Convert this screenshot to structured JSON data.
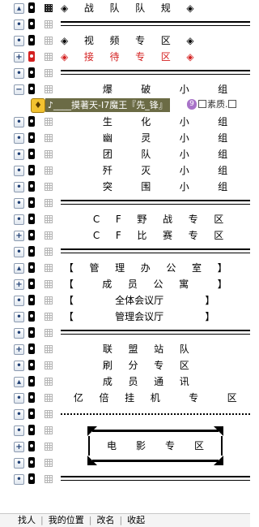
{
  "tree": [
    {
      "kind": "item",
      "ctl": "lock",
      "tag": "black",
      "grid": "dark",
      "text": "◈ 　 战 　 队 　 队 　 规 　 ◈"
    },
    {
      "kind": "sep",
      "style": "double"
    },
    {
      "kind": "item",
      "ctl": "dot",
      "tag": "black",
      "grid": "light",
      "text": "◈ 　 视 　 频 　 专 　 区 　 ◈"
    },
    {
      "kind": "item",
      "ctl": "plus",
      "tag": "red",
      "grid": "light",
      "text": "◈ 　 接 　 待 　 专 　 区 　 ◈",
      "color": "red"
    },
    {
      "kind": "sep",
      "style": "double"
    },
    {
      "kind": "item",
      "ctl": "minus",
      "tag": "black",
      "grid": "light",
      "text": "　　　　 爆 　 　 破 　 　 小 　 　 组"
    },
    {
      "kind": "user",
      "name": "♪____摸著天-Ι7魔王『先_锋』",
      "extra": "素质.",
      "extra2": "9"
    },
    {
      "kind": "item",
      "ctl": "dot",
      "tag": "black",
      "grid": "light",
      "text": "　　　　 生 　 　 化 　 　 小 　 　 组"
    },
    {
      "kind": "item",
      "ctl": "dot",
      "tag": "black",
      "grid": "light",
      "text": "　　　　 幽 　 　 灵 　 　 小 　 　 组"
    },
    {
      "kind": "item",
      "ctl": "dot",
      "tag": "black",
      "grid": "light",
      "text": "　　　　 团 　 　 队 　 　 小 　 　 组"
    },
    {
      "kind": "item",
      "ctl": "dot",
      "tag": "black",
      "grid": "light",
      "text": "　　　　 歼 　 　 灭 　 　 小 　 　 组"
    },
    {
      "kind": "item",
      "ctl": "dot",
      "tag": "black",
      "grid": "light",
      "text": "　　　　 突 　 　 围 　 　 小 　 　 组"
    },
    {
      "kind": "sep",
      "style": "double"
    },
    {
      "kind": "item",
      "ctl": "dot",
      "tag": "black",
      "grid": "light",
      "text": "　　　 C 　 F 　 野 　 战 　 专 　 区"
    },
    {
      "kind": "item",
      "ctl": "plus",
      "tag": "black",
      "grid": "light",
      "text": "　　　 C 　 F 　 比 　 赛 　 专 　 区"
    },
    {
      "kind": "sep",
      "style": "double"
    },
    {
      "kind": "item",
      "ctl": "lock",
      "tag": "black",
      "grid": "light",
      "text": " 【 　 管 　 理 　 办 　 公 　 室 　 】"
    },
    {
      "kind": "item",
      "ctl": "plus",
      "tag": "black",
      "grid": "light",
      "text": " 【 　 　 成 　 员 　 公 　 寓 　 　 】"
    },
    {
      "kind": "item",
      "ctl": "dot",
      "tag": "black",
      "grid": "light",
      "text": " 【 　 　 　 全体会议厅 　 　 　 】"
    },
    {
      "kind": "item",
      "ctl": "dot",
      "tag": "black",
      "grid": "light",
      "text": " 【 　 　 　 管理会议厅 　 　 　 】"
    },
    {
      "kind": "sep",
      "style": "double"
    },
    {
      "kind": "item",
      "ctl": "plus",
      "tag": "black",
      "grid": "light",
      "text": "　　　　 联 　 盟 　 站 　 队"
    },
    {
      "kind": "item",
      "ctl": "dot",
      "tag": "black",
      "grid": "light",
      "text": "　　　　 刷 　 分 　 专 　 区"
    },
    {
      "kind": "item",
      "ctl": "lock",
      "tag": "black",
      "grid": "light",
      "text": "　　　　 成 　 员 　 通 　 讯"
    },
    {
      "kind": "item",
      "ctl": "dot",
      "tag": "black",
      "grid": "light",
      "text": "　 亿 　 倍 　 挂 　 机 　 　 专 　 　 区"
    },
    {
      "kind": "sep",
      "style": "dotted"
    },
    {
      "kind": "item",
      "ctl": "dot",
      "tag": "black",
      "grid": "light",
      "text": ""
    },
    {
      "kind": "item",
      "ctl": "plus",
      "tag": "black",
      "grid": "light",
      "text": ""
    },
    {
      "kind": "item",
      "ctl": "dot",
      "tag": "black",
      "grid": "light",
      "text": ""
    },
    {
      "kind": "sep",
      "style": "double"
    }
  ],
  "movie_box": {
    "text": "电　　影　　专　　区"
  },
  "bottom_bar": [
    "找人",
    "我的位置",
    "改名",
    "收起"
  ],
  "colors": {
    "red": "#d42020",
    "user_bg": "#6b6b45",
    "user_icon": "#f2c230"
  }
}
